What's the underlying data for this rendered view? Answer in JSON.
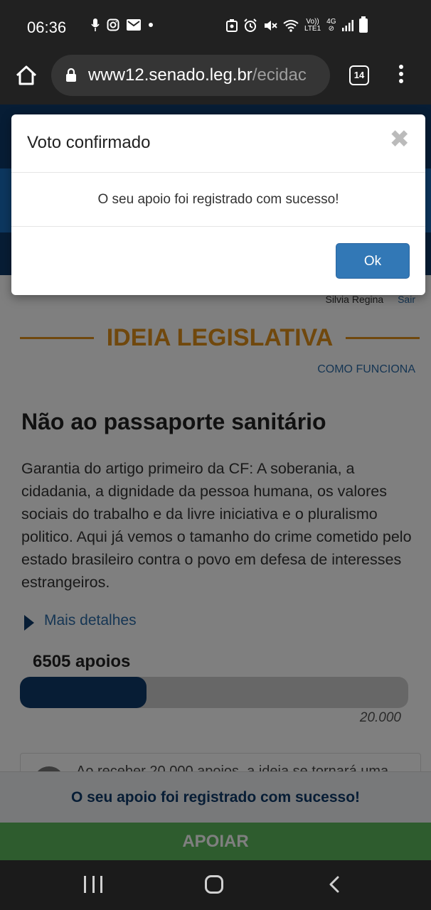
{
  "status_bar": {
    "time": "06:36",
    "left_icons": [
      "mic-icon",
      "instagram-icon",
      "mail-icon",
      "dot-icon"
    ],
    "right_icons": [
      "screenshot-icon",
      "alarm-icon",
      "mute-icon",
      "wifi-icon"
    ],
    "volte_top": "Vo))",
    "volte_bottom": "LTE1",
    "net_type": "4G"
  },
  "browser": {
    "url_main": "www12.senado.leg.br",
    "url_tail": "/ecidac",
    "tab_count": "14"
  },
  "page": {
    "user_name": "Silvia Regina",
    "logout_label": "Sair",
    "section_title": "IDEIA LEGISLATIVA",
    "how_it_works": "COMO FUNCIONA",
    "idea_title": "Não ao passaporte sanitário",
    "idea_body": "Garantia do artigo primeiro da CF: A soberania, a cidadania, a dignidade da pessoa humana, os valores sociais do trabalho e da livre iniciativa e o pluralismo politico. Aqui já vemos o tamanho do crime cometido pelo estado brasileiro contra o povo em defesa de interesses estrangeiros.",
    "details_label": "Mais detalhes",
    "supports_label": "6505 apoios",
    "supports_count": 6505,
    "supports_goal": 20000,
    "goal_label": "20.000",
    "info_text": "Ao receber 20.000 apoios, a ideia se tornará uma",
    "success_bar": "O seu apoio foi registrado com sucesso!",
    "support_button": "APOIAR",
    "colors": {
      "accent": "#e0901a",
      "navy": "#0f3a6b",
      "green": "#5cb85c",
      "link": "#2d6ca8"
    }
  },
  "modal": {
    "title": "Voto confirmado",
    "close_symbol": "✖",
    "message": "O seu apoio foi registrado com sucesso!",
    "ok_label": "Ok"
  }
}
